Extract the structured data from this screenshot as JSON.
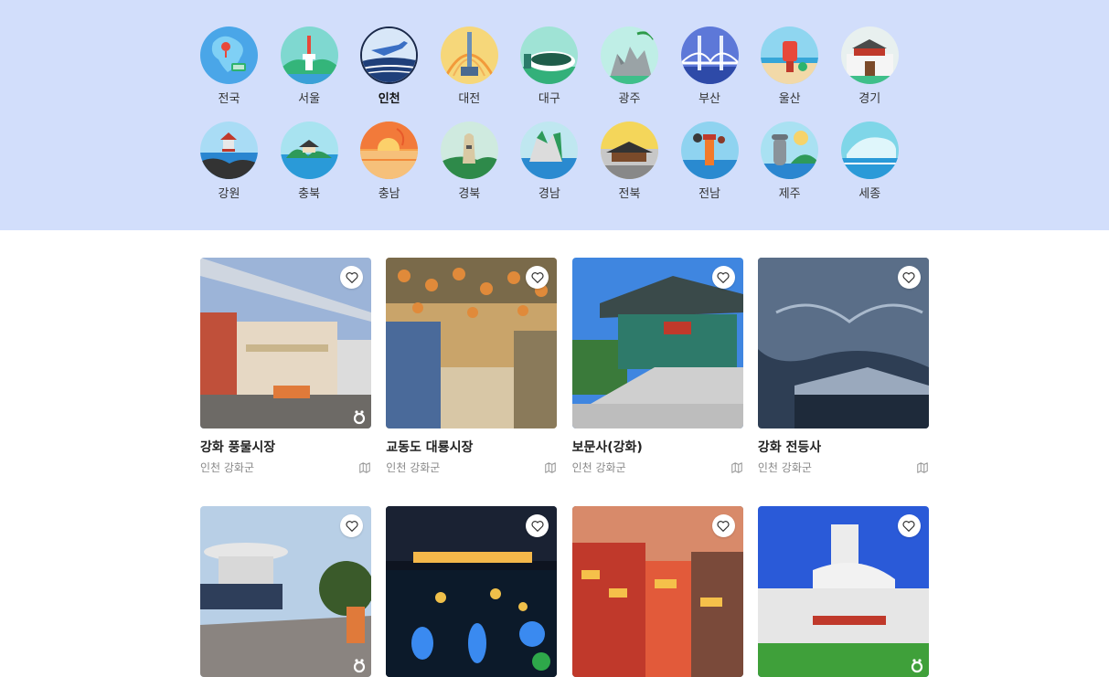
{
  "regions": {
    "row1": [
      {
        "label": "전국",
        "icon": "korea-map-icon"
      },
      {
        "label": "서울",
        "icon": "seoul-tower-icon"
      },
      {
        "label": "인천",
        "icon": "incheon-airport-icon",
        "selected": true
      },
      {
        "label": "대전",
        "icon": "daejeon-tower-icon"
      },
      {
        "label": "대구",
        "icon": "daegu-stadium-icon"
      },
      {
        "label": "광주",
        "icon": "gwangju-mountain-icon"
      },
      {
        "label": "부산",
        "icon": "busan-bridge-icon"
      },
      {
        "label": "울산",
        "icon": "ulsan-mailbox-icon"
      },
      {
        "label": "경기",
        "icon": "gyeonggi-fortress-icon"
      }
    ],
    "row2": [
      {
        "label": "강원",
        "icon": "gangwon-pavilion-icon"
      },
      {
        "label": "충북",
        "icon": "chungbuk-island-icon"
      },
      {
        "label": "충남",
        "icon": "chungnam-sunset-icon"
      },
      {
        "label": "경북",
        "icon": "gyeongbuk-observatory-icon"
      },
      {
        "label": "경남",
        "icon": "gyeongnam-cliffs-icon"
      },
      {
        "label": "전북",
        "icon": "jeonbuk-hanok-icon"
      },
      {
        "label": "전남",
        "icon": "jeonnam-lighthouse-icon"
      },
      {
        "label": "제주",
        "icon": "jeju-dolhareubang-icon"
      },
      {
        "label": "세종",
        "icon": "sejong-building-icon"
      }
    ]
  },
  "places": [
    {
      "title": "강화 풍물시장",
      "location": "인천 강화군",
      "watermark": true
    },
    {
      "title": "교동도 대룡시장",
      "location": "인천 강화군",
      "watermark": false
    },
    {
      "title": "보문사(강화)",
      "location": "인천 강화군",
      "watermark": false
    },
    {
      "title": "강화 전등사",
      "location": "인천 강화군",
      "watermark": false
    },
    {
      "title": "",
      "location": "",
      "watermark": true
    },
    {
      "title": "",
      "location": "",
      "watermark": false
    },
    {
      "title": "",
      "location": "",
      "watermark": false
    },
    {
      "title": "",
      "location": "",
      "watermark": true
    }
  ],
  "colors": {
    "band_bg": "#d2defb",
    "selected_ring": "#1b2a4a"
  }
}
